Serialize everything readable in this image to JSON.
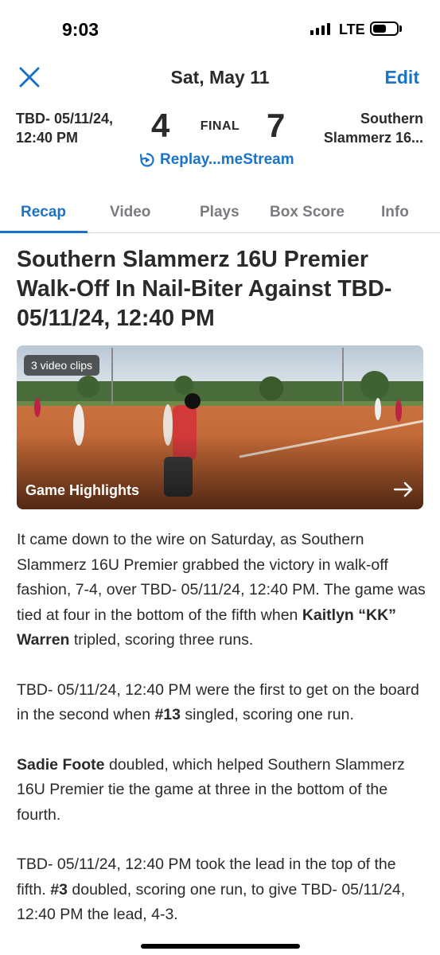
{
  "status": {
    "time": "9:03",
    "network": "LTE"
  },
  "header": {
    "date": "Sat, May 11",
    "edit_label": "Edit"
  },
  "game": {
    "away_team_line1": "TBD- 05/11/24,",
    "away_team_line2": "12:40 PM",
    "away_score": "4",
    "status": "FINAL",
    "home_score": "7",
    "home_team_line1": "Southern",
    "home_team_line2": "Slammerz 16...",
    "replay_label": "Replay...meStream"
  },
  "tabs": [
    {
      "label": "Recap",
      "active": true
    },
    {
      "label": "Video",
      "active": false
    },
    {
      "label": "Plays",
      "active": false
    },
    {
      "label": "Box Score",
      "active": false
    },
    {
      "label": "Info",
      "active": false
    }
  ],
  "article": {
    "headline": "Southern Slammerz 16U Premier Walk-Off In Nail-Biter Against TBD- 05/11/24, 12:40 PM",
    "media": {
      "badge": "3 video clips",
      "title": "Game Highlights"
    },
    "p1_a": "It came down to the wire on Saturday, as Southern Slammerz 16U Premier grabbed the victory in walk-off fashion, 7-4, over TBD- 05/11/24, 12:40 PM. The game was tied at four in the bottom of the fifth when ",
    "p1_b": "Kaitlyn “KK” Warren",
    "p1_c": " tripled, scoring three runs.",
    "p2_a": "TBD- 05/11/24, 12:40 PM were the first to get on the board in the second when ",
    "p2_b": "#13",
    "p2_c": " singled, scoring one run.",
    "p3_a": "Sadie Foote",
    "p3_b": " doubled, which helped Southern Slammerz 16U Premier tie the game at three in the bottom of the fourth.",
    "p4_a": "TBD- 05/11/24, 12:40 PM took the lead in the top of the fifth. ",
    "p4_b": "#3",
    "p4_c": " doubled, scoring one run, to give TBD- 05/11/24, 12:40 PM the lead, 4-3."
  },
  "colors": {
    "accent": "#1a73c9",
    "text": "#2a2a2c",
    "muted": "#7b7b80"
  }
}
